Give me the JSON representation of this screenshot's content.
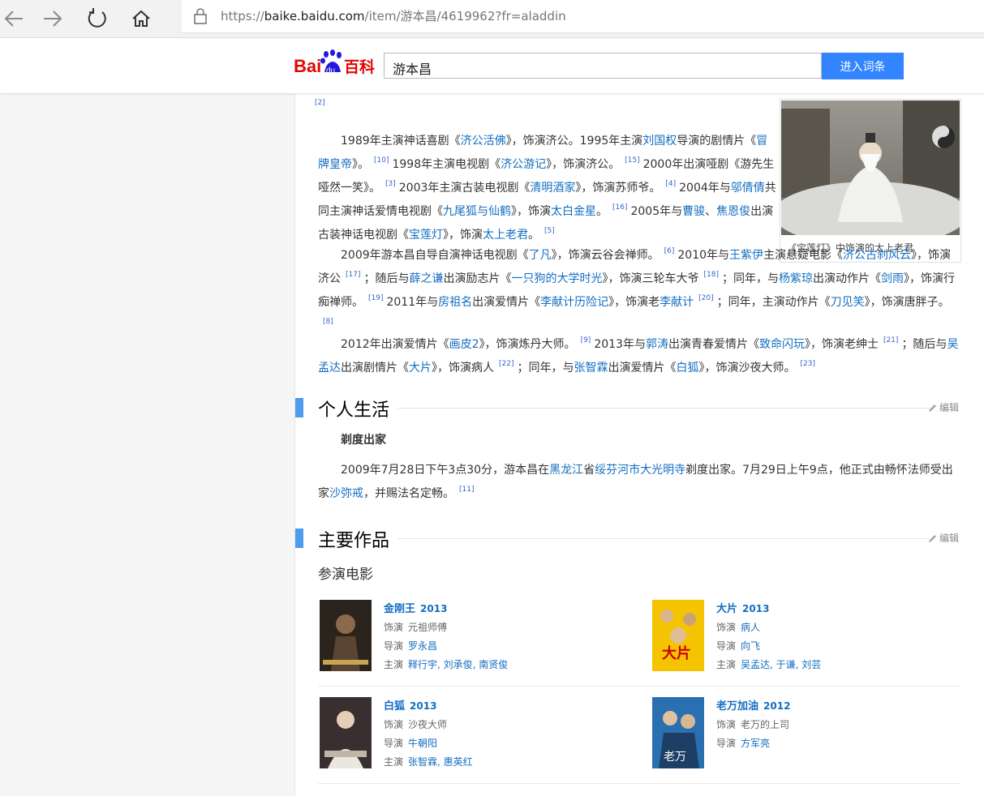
{
  "browser": {
    "url_prefix": "https://",
    "url_host": "baike.baidu.com",
    "url_path": "/item/游本昌/4619962?fr=aladdin"
  },
  "header": {
    "search_value": "游本昌",
    "search_button": "进入词条",
    "logo_text_bai": "Bai",
    "logo_text_du": "du",
    "logo_text_baike": "百科"
  },
  "top_partial": {
    "sup": "[2]"
  },
  "career": {
    "p1": {
      "t1": "1989年主演神话喜剧《",
      "l1": "济公活佛",
      "t2": "》，饰演济公。1995年主演",
      "l2": "刘国权",
      "t3": "导演的剧情片《",
      "l3": "冒牌皇帝",
      "t4": "》。",
      "s1": "[10]",
      "t5": "1998年主演电视剧《",
      "l4": "济公游记",
      "t6": "》，饰演济公。",
      "s2": "[15]",
      "t7": "2000年出演哑剧《游先生哑然一笑》。",
      "s3": "[3]",
      "t8": "2003年主演古装电视剧《",
      "l5": "清明酒家",
      "t9": "》，饰演苏师爷。",
      "s4": "[4]",
      "t10": "2004年与",
      "l6": "邬倩倩",
      "t11": "共同主演神话爱情电视剧《",
      "l7": "九尾狐与仙鹤",
      "t12": "》，饰演",
      "l8": "太白金星",
      "t13": "。",
      "s5": "[16]",
      "t14": "2005年与",
      "l9": "曹骏",
      "t15": "、",
      "l10": "焦恩俊",
      "t16": "出演古装神话电视剧《",
      "l11": "宝莲灯",
      "t17": "》，饰演",
      "l12": "太上老君",
      "t18": "。",
      "s6": "[5]"
    },
    "p2": {
      "t1": "2009年游本昌自导自演神话电视剧《",
      "l1": "了凡",
      "t2": "》，饰演云谷会禅师。",
      "s1": "[6]",
      "t3": "2010年与",
      "l2": "王紫伊",
      "t4": "主演悬疑电影《",
      "l3": "济公古刹风云",
      "t5": "》，饰演济公",
      "s2": "[17]",
      "t6": "；随后与",
      "l4": "薛之谦",
      "t7": "出演励志片《",
      "l5": "一只狗的大学时光",
      "t8": "》，饰演三轮车大爷",
      "s3": "[18]",
      "t9": "；同年，与",
      "l6": "杨紫琼",
      "t10": "出演动作片《",
      "l7": "剑雨",
      "t11": "》，饰演行痴禅师。",
      "s4": "[19]",
      "t12": "2011年与",
      "l8": "房祖名",
      "t13": "出演爱情片《",
      "l9": "李献计历险记",
      "t14": "》，饰演老",
      "l10": "李献计",
      "s5": "[20]",
      "t15": "；同年，主演动作片《",
      "l11": "刀见笑",
      "t16": "》，饰演唐胖子。",
      "s6": "[8]"
    },
    "p3": {
      "t1": "2012年出演爱情片《",
      "l1": "画皮2",
      "t2": "》，饰演炼丹大师。",
      "s1": "[9]",
      "t3": "2013年与",
      "l2": "郭涛",
      "t4": "出演青春爱情片《",
      "l3": "致命闪玩",
      "t5": "》，饰演老绅士",
      "s2": "[21]",
      "t6": "；随后与",
      "l4": "吴孟达",
      "t7": "出演剧情片《",
      "l5": "大片",
      "t8": "》，饰演病人",
      "s3": "[22]",
      "t9": "；同年，与",
      "l6": "张智霖",
      "t10": "出演爱情片《",
      "l7": "白狐",
      "t11": "》，饰演沙夜大师。",
      "s4": "[23]"
    }
  },
  "figure": {
    "caption": "《宝莲灯》中饰演的太上老君"
  },
  "section_life": {
    "title": "个人生活",
    "edit": "编辑",
    "subhead": "剃度出家",
    "t1": "2009年7月28日下午3点30分，游本昌在",
    "l1": "黑龙江",
    "t2": "省",
    "l2": "绥芬河市大光明寺",
    "t3": "剃度出家。7月29日上午9点，他正式由畅怀法师受出家",
    "l3": "沙弥戒",
    "t4": "，并赐法名定畅。",
    "s1": "[11]"
  },
  "section_works": {
    "title": "主要作品",
    "edit": "编辑",
    "films_label": "参演电影",
    "films": [
      {
        "title": "金刚王",
        "year": "2013",
        "role_label": "饰演",
        "role": "元祖师傅",
        "director_label": "导演",
        "director": "罗永昌",
        "cast_label": "主演",
        "cast": "释行宇, 刘承俊, 南贤俊"
      },
      {
        "title": "大片",
        "year": "2013",
        "role_label": "饰演",
        "role": "病人",
        "director_label": "导演",
        "director": "向飞",
        "cast_label": "主演",
        "cast": "吴孟达, 于谦, 刘芸"
      },
      {
        "title": "白狐",
        "year": "2013",
        "role_label": "饰演",
        "role": "沙夜大师",
        "director_label": "导演",
        "director": "牛朝阳",
        "cast_label": "主演",
        "cast": "张智霖, 惠英红"
      },
      {
        "title": "老万加油",
        "year": "2012",
        "role_label": "饰演",
        "role": "老万的上司",
        "director_label": "导演",
        "director": "方军亮"
      }
    ]
  },
  "colors": {
    "link": "#136ec2",
    "accent": "#3385ff",
    "section_bar": "#4f9cee"
  }
}
